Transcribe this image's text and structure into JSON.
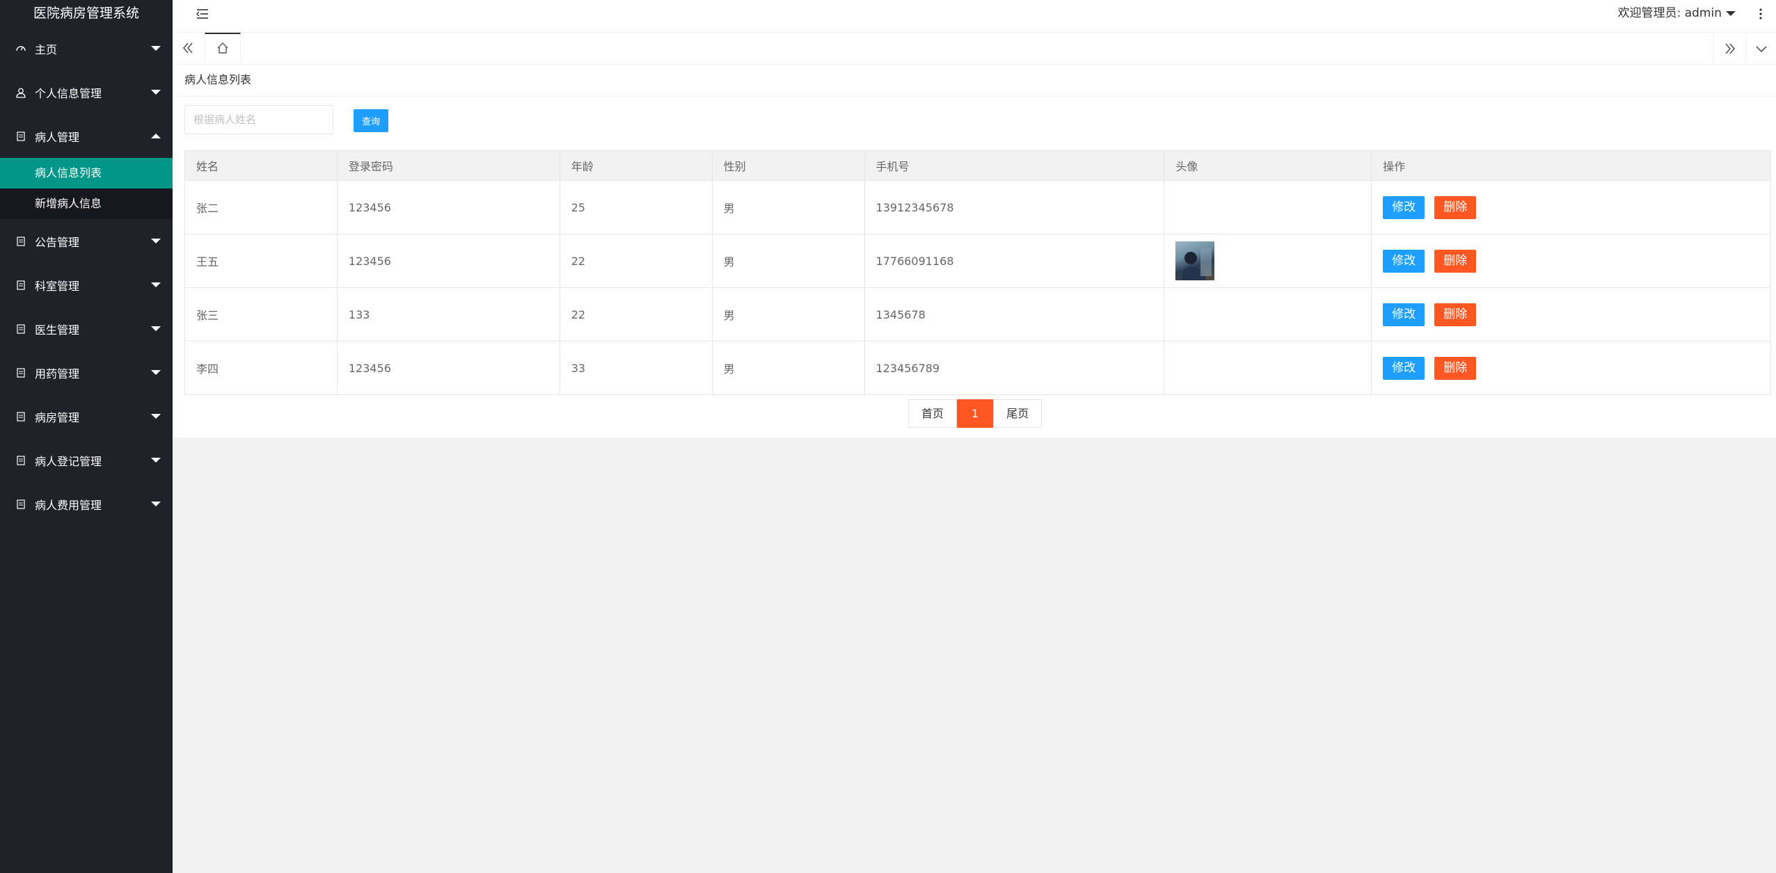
{
  "app": {
    "title": "医院病房管理系统"
  },
  "sidebar": {
    "items": [
      {
        "label": "主页",
        "icon": "dashboard-icon",
        "expanded": false
      },
      {
        "label": "个人信息管理",
        "icon": "user-icon",
        "expanded": false
      },
      {
        "label": "病人管理",
        "icon": "document-icon",
        "expanded": true,
        "children": [
          {
            "label": "病人信息列表",
            "active": true
          },
          {
            "label": "新增病人信息",
            "active": false
          }
        ]
      },
      {
        "label": "公告管理",
        "icon": "document-icon",
        "expanded": false
      },
      {
        "label": "科室管理",
        "icon": "document-icon",
        "expanded": false
      },
      {
        "label": "医生管理",
        "icon": "document-icon",
        "expanded": false
      },
      {
        "label": "用药管理",
        "icon": "document-icon",
        "expanded": false
      },
      {
        "label": "病房管理",
        "icon": "document-icon",
        "expanded": false
      },
      {
        "label": "病人登记管理",
        "icon": "document-icon",
        "expanded": false
      },
      {
        "label": "病人费用管理",
        "icon": "document-icon",
        "expanded": false
      }
    ]
  },
  "header": {
    "welcome": "欢迎管理员: admin"
  },
  "page": {
    "title": "病人信息列表",
    "search": {
      "placeholder": "根据病人姓名",
      "value": "",
      "button": "查询"
    }
  },
  "table": {
    "columns": [
      "姓名",
      "登录密码",
      "年龄",
      "性别",
      "手机号",
      "头像",
      "操作"
    ],
    "rows": [
      {
        "name": "张二",
        "password": "123456",
        "age": "25",
        "gender": "男",
        "phone": "13912345678",
        "avatar": false
      },
      {
        "name": "王五",
        "password": "123456",
        "age": "22",
        "gender": "男",
        "phone": "17766091168",
        "avatar": true
      },
      {
        "name": "张三",
        "password": "133",
        "age": "22",
        "gender": "男",
        "phone": "1345678",
        "avatar": false
      },
      {
        "name": "李四",
        "password": "123456",
        "age": "33",
        "gender": "男",
        "phone": "123456789",
        "avatar": false
      }
    ],
    "actions": {
      "edit": "修改",
      "delete": "删除"
    }
  },
  "pager": {
    "first": "首页",
    "current": "1",
    "last": "尾页"
  },
  "colors": {
    "sidebar": "#20222a",
    "active": "#009688",
    "primary": "#1e9fff",
    "danger": "#ff5722"
  }
}
